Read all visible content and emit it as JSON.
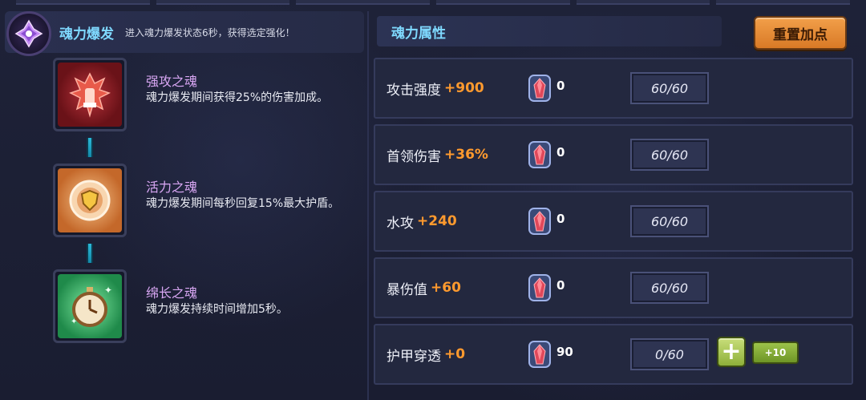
{
  "burst": {
    "title": "魂力爆发",
    "description": "进入魂力爆发状态6秒，获得选定强化！"
  },
  "souls": [
    {
      "name": "强攻之魂",
      "description": "魂力爆发期间获得25%的伤害加成。",
      "icon": "flame-fist-icon"
    },
    {
      "name": "活力之魂",
      "description": "魂力爆发期间每秒回复15%最大护盾。",
      "icon": "shield-gear-icon"
    },
    {
      "name": "绵长之魂",
      "description": "魂力爆发持续时间增加5秒。",
      "icon": "stopwatch-icon"
    }
  ],
  "attributes_panel": {
    "title": "魂力属性",
    "reset_label": "重置加点"
  },
  "attributes": [
    {
      "name": "攻击强度",
      "bonus": "+900",
      "gems": "0",
      "level": "60/60"
    },
    {
      "name": "首领伤害",
      "bonus": "+36%",
      "gems": "0",
      "level": "60/60"
    },
    {
      "name": "水攻",
      "bonus": "+240",
      "gems": "0",
      "level": "60/60"
    },
    {
      "name": "暴伤值",
      "bonus": "+60",
      "gems": "0",
      "level": "60/60"
    },
    {
      "name": "护甲穿透",
      "bonus": "+0",
      "gems": "90",
      "level": "0/60",
      "plus_label": "+",
      "plus10_label": "+10"
    }
  ],
  "colors": {
    "accent_cyan": "#7fd9ff",
    "soul_name": "#d9a7f4",
    "bonus_orange": "#ff9a2e",
    "reset_orange": "#e8913a",
    "add_green": "#9cc24a"
  }
}
